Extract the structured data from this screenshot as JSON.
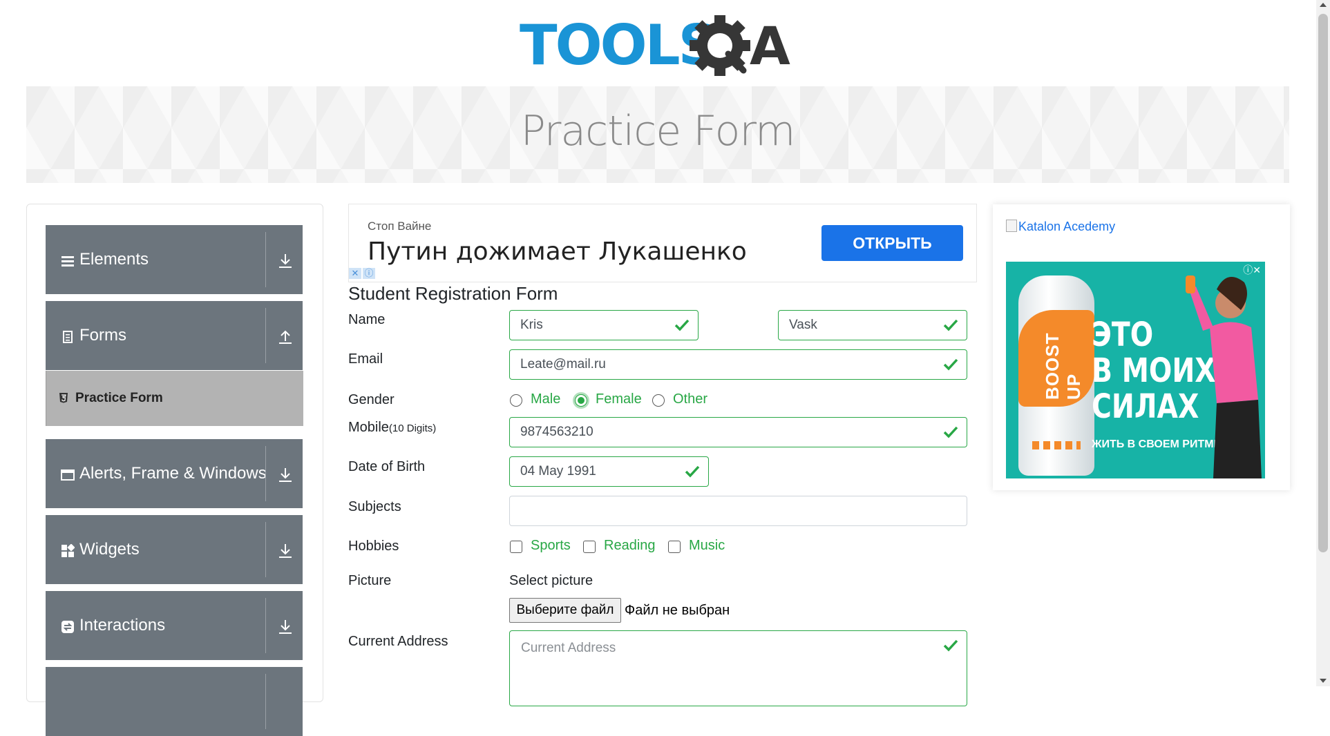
{
  "header": {
    "logo_text": "TOOLSQA",
    "banner_title": "Practice Form"
  },
  "sidebar": {
    "groups": [
      {
        "label": "Elements",
        "icon": "menu-lines-icon",
        "arrow": "download-icon"
      },
      {
        "label": "Forms",
        "icon": "document-icon",
        "arrow": "upload-icon"
      },
      {
        "label": "Alerts, Frame & Windows",
        "icon": "window-icon",
        "arrow": "download-icon"
      },
      {
        "label": "Widgets",
        "icon": "widgets-icon",
        "arrow": "download-icon"
      },
      {
        "label": "Interactions",
        "icon": "interactions-icon",
        "arrow": "download-icon"
      }
    ],
    "active_item": {
      "label": "Practice Form",
      "icon": "html5-icon"
    }
  },
  "ad_top": {
    "small_text": "Стоп Вайне",
    "headline": "Путин дожимает Лукашенко",
    "button_label": "ОТКРЫТЬ",
    "close_glyph": "✕",
    "info_glyph": "ⓘ"
  },
  "form": {
    "title": "Student Registration Form",
    "name_label": "Name",
    "first_name": "Kris",
    "last_name": "Vask",
    "email_label": "Email",
    "email": "Leate@mail.ru",
    "gender_label": "Gender",
    "gender_options": [
      "Male",
      "Female",
      "Other"
    ],
    "gender_selected": "Female",
    "mobile_label": "Mobile",
    "mobile_hint": "(10 Digits)",
    "mobile": "9874563210",
    "dob_label": "Date of Birth",
    "dob": "04 May 1991",
    "subjects_label": "Subjects",
    "subjects": "",
    "hobbies_label": "Hobbies",
    "hobbies": [
      "Sports",
      "Reading",
      "Music"
    ],
    "picture_label": "Picture",
    "select_picture": "Select picture",
    "file_button": "Выберите файл",
    "file_status": "Файл не выбран",
    "address_label": "Current Address",
    "address_placeholder": "Current Address",
    "valid_color": "#28a745"
  },
  "ad_right": {
    "broken_image_alt": "Katalon Acedemy",
    "promo_brand": "BOOST UP",
    "promo_headline_1": "ЭТО",
    "promo_headline_2": "В МОИХ",
    "promo_headline_3": "СИЛАХ",
    "promo_tagline": "ЖИТЬ В СВОЕМ РИТМЕ",
    "promo_close": "ⓘ✕"
  }
}
